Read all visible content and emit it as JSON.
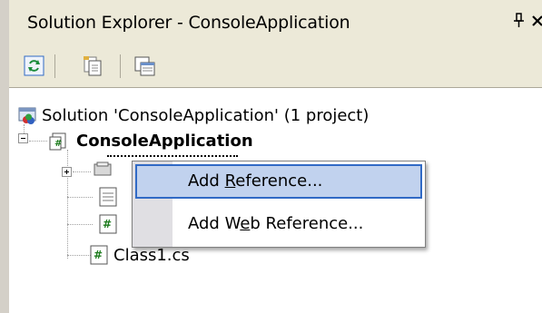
{
  "window": {
    "title": "Solution Explorer - ConsoleApplication",
    "pin_icon": "pin-icon",
    "close_icon": "close-icon"
  },
  "toolbar": {
    "buttons": [
      {
        "name": "refresh-button",
        "icon": "refresh-icon"
      },
      {
        "name": "show-all-files-button",
        "icon": "show-all-files-icon"
      },
      {
        "name": "properties-button",
        "icon": "properties-icon"
      }
    ]
  },
  "tree": {
    "solution_label": "Solution 'ConsoleApplication' (1 project)",
    "project_label": "ConsoleApplication",
    "class_file_label": "Class1.cs"
  },
  "context_menu": {
    "items": [
      {
        "before": "Add ",
        "mnemonic": "R",
        "after": "eference...",
        "selected": true
      },
      {
        "before": "Add W",
        "mnemonic": "e",
        "after": "b Reference...",
        "selected": false
      }
    ]
  },
  "colors": {
    "menu_highlight": "#c1d2ee",
    "menu_highlight_border": "#316ac5",
    "panel_background": "#ece9d8"
  }
}
